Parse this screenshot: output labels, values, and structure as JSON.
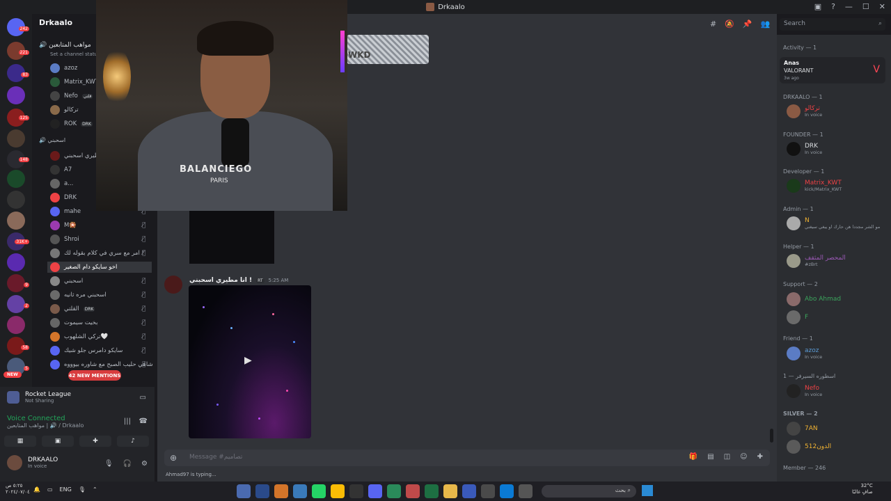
{
  "window": {
    "title": "Drkaalo",
    "controls": [
      "—",
      "☐",
      "✕"
    ]
  },
  "server_rail": {
    "badges": [
      "242",
      "221",
      "83",
      "125",
      "148",
      "31K+",
      "9",
      "2",
      "58",
      "5"
    ],
    "new_label": "NEW"
  },
  "channel_list": {
    "server_name": "Drkaalo",
    "voice_channel_1": "مواهب المتابعين",
    "set_status": "Set a channel status",
    "voice_channel_2": "اسحبني",
    "members_top": [
      {
        "name": "azoz"
      },
      {
        "name": "Matrix_KWT"
      },
      {
        "name": "Nefo",
        "tag": "قلتي"
      },
      {
        "name": "تركالو"
      },
      {
        "name": "ROK",
        "tag": "DRK"
      }
    ],
    "members_bottom": [
      {
        "name": "مطيري اسحبني !"
      },
      {
        "name": "A7"
      },
      {
        "name": "a..."
      },
      {
        "name": "DRK"
      },
      {
        "name": "mahe"
      },
      {
        "name": "M🎇"
      },
      {
        "name": "Shroi"
      },
      {
        "name": "امر مع سري في كلام بقوله لك !"
      },
      {
        "name": "اخو سايكو دام الصغير"
      },
      {
        "name": "اسحبني"
      },
      {
        "name": "اسحبني مره ثانيه"
      },
      {
        "name": "القلتي",
        "tag": "DRK"
      },
      {
        "name": "بخيت سيموت"
      },
      {
        "name": "تركي الشلهوب🤍"
      },
      {
        "name": "سايكو دامرس جلو شيك"
      },
      {
        "name": "شاهي حليب الصبح مع شاوره بيوووه"
      }
    ],
    "mentions": "42 NEW MENTIONS"
  },
  "activity": {
    "game": "Rocket League",
    "sharing": "Not Sharing",
    "voice_status": "Voice Connected",
    "voice_location": "مواهب المتابعين | 🔊 / Drkaalo"
  },
  "user": {
    "name": "DRKAALO",
    "status": "In voice"
  },
  "webcam": {
    "shirt_brand": "BALANCIEGO",
    "shirt_sub": "PARIS"
  },
  "chat": {
    "image_text": "WKD",
    "message": {
      "author": "انا مطيري اسحبني !",
      "tag": "RT",
      "time": "5:25 AM"
    },
    "input_placeholder": "Message #تصاميم",
    "typing": "Ahmad97 is typing..."
  },
  "header": {
    "search_placeholder": "Search"
  },
  "member_list": {
    "activity_heading": "Activity — 1",
    "activity_card": {
      "user": "Anas",
      "game": "VALORANT",
      "time": "3w ago"
    },
    "groups": [
      {
        "heading": "DRKAALO — 1",
        "members": [
          {
            "name": "تركالو",
            "color": "#ed4245",
            "status": "In voice"
          }
        ]
      },
      {
        "heading": "FOUNDER — 1",
        "members": [
          {
            "name": "DRK",
            "color": "#dbdee1",
            "status": "In voice"
          }
        ]
      },
      {
        "heading": "Developer — 1",
        "members": [
          {
            "name": "Matrix_KWT",
            "color": "#ed4245",
            "status": "kick/Matrix_KWT"
          }
        ]
      },
      {
        "heading": "Admin — 1",
        "members": [
          {
            "name": "N",
            "color": "#f0b232",
            "status": "مو الشر مجددا هن حارك او يبغي سيغني"
          }
        ]
      },
      {
        "heading": "Helper — 1",
        "members": [
          {
            "name": "المحصر المثقف",
            "color": "#9b59b6",
            "status": "#zBrt"
          }
        ]
      },
      {
        "heading": "Support — 2",
        "members": [
          {
            "name": "Abo Ahmad",
            "color": "#3ba55d",
            "status": ""
          },
          {
            "name": "F",
            "color": "#3ba55d",
            "status": ""
          }
        ]
      },
      {
        "heading": "Friend — 1",
        "members": [
          {
            "name": "azoz",
            "color": "#5b9bd5",
            "status": "In voice"
          }
        ]
      },
      {
        "heading": "اسطوره السيرفر — 1",
        "members": [
          {
            "name": "Nefo",
            "color": "#ed4245",
            "status": "In voice"
          }
        ]
      },
      {
        "heading": "SILVER — 2",
        "members": [
          {
            "name": "7AN",
            "color": "#f0b232",
            "status": ""
          },
          {
            "name": "الدون512",
            "color": "#f0b232",
            "status": ""
          }
        ]
      },
      {
        "heading": "Member — 246",
        "members": []
      }
    ]
  },
  "taskbar": {
    "time": "٥:٢٥ ص",
    "date": "٢٠٢٤/٠٧/٠٤",
    "lang": "ENG",
    "search_placeholder": "بحث",
    "weather_temp": "32°C",
    "weather_desc": "صافٍ غالبًا"
  }
}
